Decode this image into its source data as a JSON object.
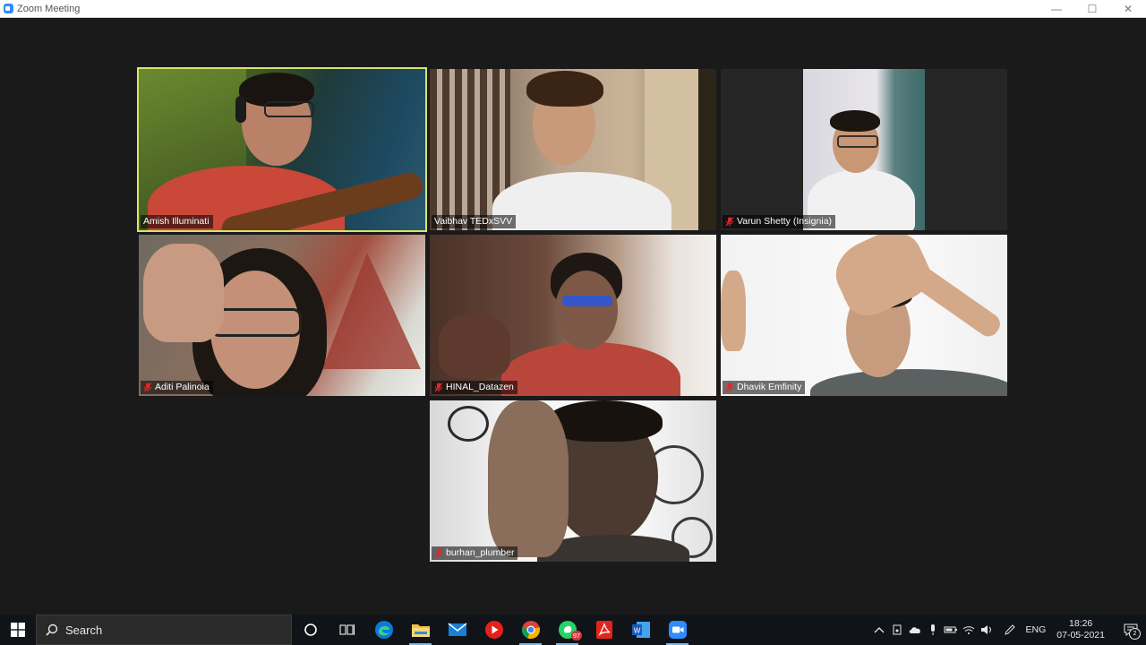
{
  "window": {
    "title": "Zoom Meeting",
    "controls": {
      "minimize": "—",
      "maximize": "☐",
      "close": "✕"
    }
  },
  "meeting": {
    "active_speaker_color": "#d9e36a",
    "participants": [
      {
        "name": "Amish Illuminati",
        "muted": false,
        "active": true
      },
      {
        "name": "Vaibhav TEDxSVV",
        "muted": false,
        "active": false
      },
      {
        "name": "Varun Shetty (Insignia)",
        "muted": true,
        "active": false
      },
      {
        "name": "Aditi Palinoia",
        "muted": true,
        "active": false
      },
      {
        "name": "HINAL_Datazen",
        "muted": true,
        "active": false
      },
      {
        "name": "Dhavik Emfinity",
        "muted": true,
        "active": false
      },
      {
        "name": "burhan_plumber",
        "muted": true,
        "active": false
      }
    ]
  },
  "taskbar": {
    "search_placeholder": "Search",
    "apps": [
      "cortana-icon",
      "task-view-icon",
      "edge-icon",
      "file-explorer-icon",
      "mail-icon",
      "youtube-icon",
      "chrome-icon",
      "whatsapp-icon",
      "acrobat-icon",
      "word-icon",
      "zoom-icon"
    ],
    "whatsapp_badge": "97",
    "language": "ENG",
    "time": "18:26",
    "date": "07-05-2021",
    "notification_count": "2"
  }
}
